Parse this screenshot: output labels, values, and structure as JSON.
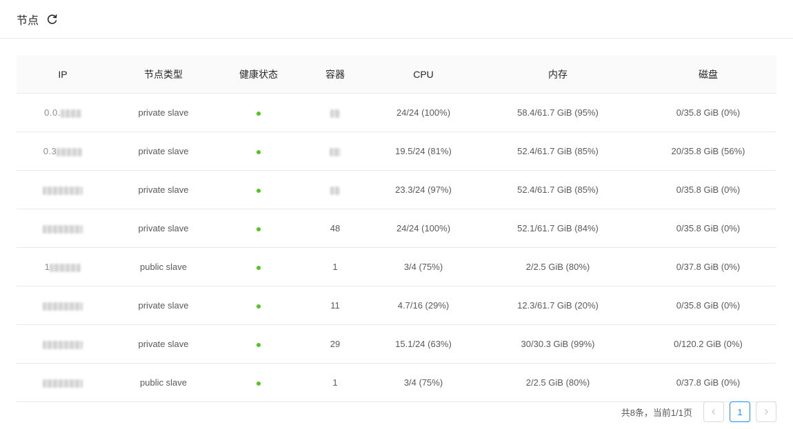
{
  "header": {
    "title": "节点"
  },
  "colors": {
    "health_ok": "#52c41a",
    "accent": "#1890ff"
  },
  "table": {
    "columns": [
      "IP",
      "节点类型",
      "健康状态",
      "容器",
      "CPU",
      "内存",
      "磁盘"
    ],
    "rows": [
      {
        "ip": "0.0.",
        "type": "private slave",
        "health": "healthy",
        "containers": "",
        "cpu": "24/24 (100%)",
        "memory": "58.4/61.7 GiB (95%)",
        "disk": "0/35.8 GiB (0%)"
      },
      {
        "ip": "0.3",
        "type": "private slave",
        "health": "healthy",
        "containers": "",
        "cpu": "19.5/24 (81%)",
        "memory": "52.4/61.7 GiB (85%)",
        "disk": "20/35.8 GiB (56%)"
      },
      {
        "ip": "",
        "type": "private slave",
        "health": "healthy",
        "containers": "",
        "cpu": "23.3/24 (97%)",
        "memory": "52.4/61.7 GiB (85%)",
        "disk": "0/35.8 GiB (0%)"
      },
      {
        "ip": "",
        "type": "private slave",
        "health": "healthy",
        "containers": "48",
        "cpu": "24/24 (100%)",
        "memory": "52.1/61.7 GiB (84%)",
        "disk": "0/35.8 GiB (0%)"
      },
      {
        "ip": "1",
        "type": "public slave",
        "health": "healthy",
        "containers": "1",
        "cpu": "3/4 (75%)",
        "memory": "2/2.5 GiB (80%)",
        "disk": "0/37.8 GiB (0%)"
      },
      {
        "ip": "",
        "type": "private slave",
        "health": "healthy",
        "containers": "11",
        "cpu": "4.7/16 (29%)",
        "memory": "12.3/61.7 GiB (20%)",
        "disk": "0/35.8 GiB (0%)"
      },
      {
        "ip": "",
        "type": "private slave",
        "health": "healthy",
        "containers": "29",
        "cpu": "15.1/24 (63%)",
        "memory": "30/30.3 GiB (99%)",
        "disk": "0/120.2 GiB (0%)"
      },
      {
        "ip": "",
        "type": "public slave",
        "health": "healthy",
        "containers": "1",
        "cpu": "3/4 (75%)",
        "memory": "2/2.5 GiB (80%)",
        "disk": "0/37.8 GiB (0%)"
      }
    ]
  },
  "pagination": {
    "summary": "共8条，当前1/1页",
    "current_page": "1",
    "prev_icon": "chevron-left-icon",
    "next_icon": "chevron-right-icon"
  }
}
